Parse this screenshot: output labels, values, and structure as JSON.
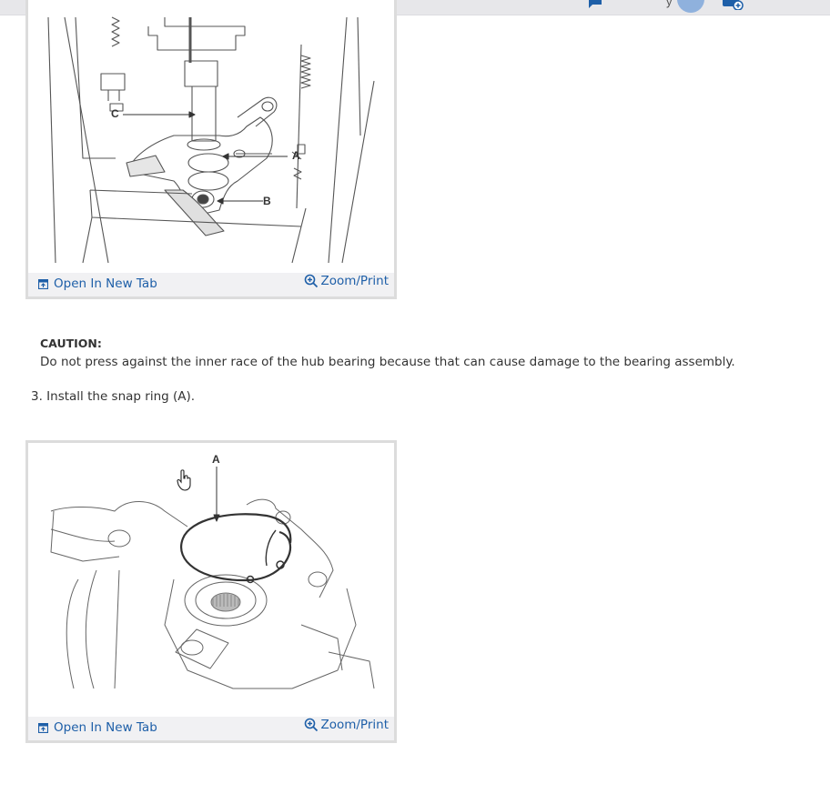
{
  "top_bar": {
    "left_fragment": "y",
    "mid_fragment": "y",
    "icons": [
      "chat-icon",
      "calendar-add-icon",
      "user-avatar"
    ]
  },
  "figure_1": {
    "callouts": [
      "C",
      "A",
      "B"
    ],
    "open_tab_label": "Open In New Tab",
    "zoom_label": "Zoom/Print"
  },
  "caution": {
    "heading": "CAUTION:",
    "text": "Do not press against the inner race of the hub bearing because that can cause damage to the bearing assembly."
  },
  "step": {
    "text": "3. Install the snap ring (A)."
  },
  "figure_2": {
    "callouts": [
      "A"
    ],
    "open_tab_label": "Open In New Tab",
    "zoom_label": "Zoom/Print"
  },
  "colors": {
    "link": "#1e5fa8",
    "footer_bg": "#f1f1f3",
    "frame": "#dcdcdc"
  }
}
